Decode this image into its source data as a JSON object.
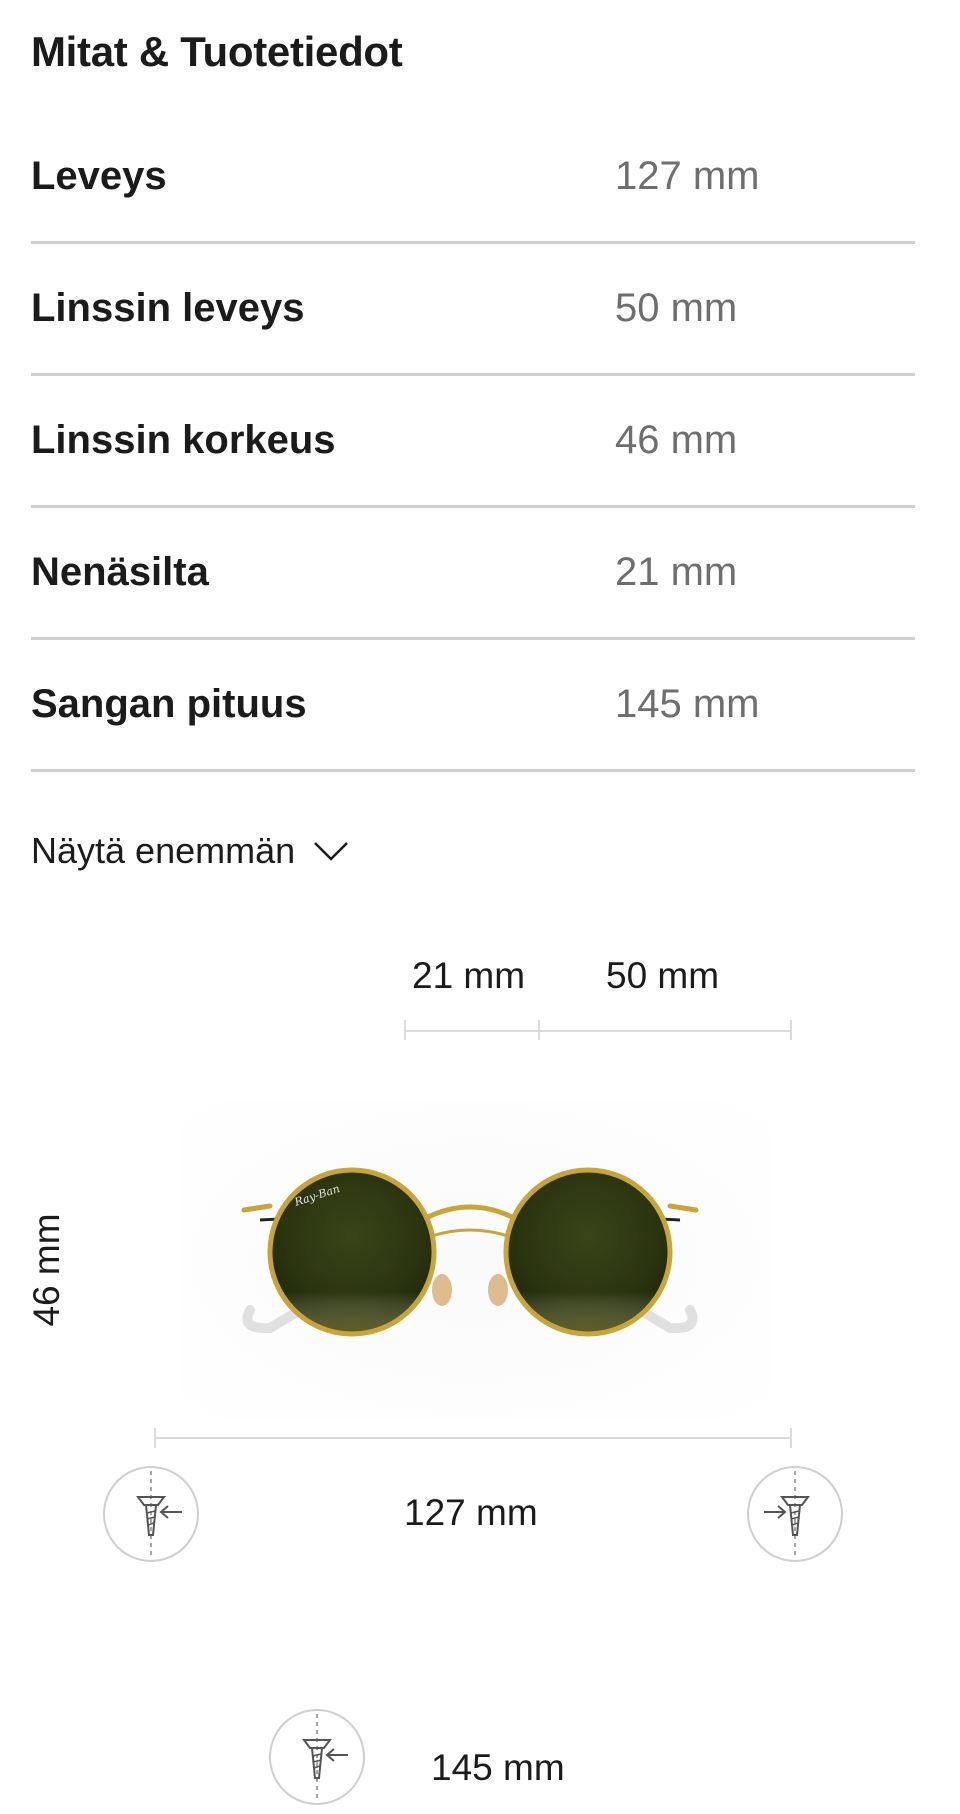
{
  "header": {
    "title": "Mitat & Tuotetiedot"
  },
  "specs": [
    {
      "label": "Leveys",
      "value": "127 mm"
    },
    {
      "label": "Linssin leveys",
      "value": "50 mm"
    },
    {
      "label": "Linssin korkeus",
      "value": "46 mm"
    },
    {
      "label": "Nenäsilta",
      "value": "21 mm"
    },
    {
      "label": "Sangan pituus",
      "value": "145 mm"
    }
  ],
  "show_more": {
    "label": "Näytä enemmän",
    "icon": "chevron-down-icon"
  },
  "diagram": {
    "bridge": "21 mm",
    "lens_width": "50 mm",
    "lens_height": "46 mm",
    "total_width": "127 mm",
    "temple_length": "145 mm",
    "brand_mark": "Ray-Ban",
    "icons": [
      "screw-left-icon",
      "screw-right-icon",
      "temple-screw-icon"
    ],
    "colors": {
      "frame_gold": "#c9a43a",
      "lens_green": "#2f3a14",
      "divider": "#cfcfcf",
      "value_gray": "#6e6e6e"
    }
  }
}
